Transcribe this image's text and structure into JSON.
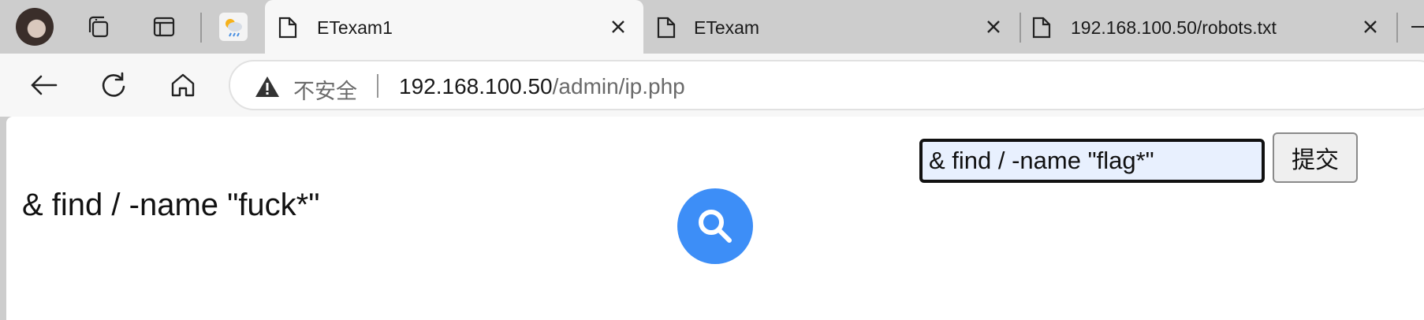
{
  "tabs": [
    {
      "title": "ETexam1",
      "active": true
    },
    {
      "title": "ETexam",
      "active": false
    },
    {
      "title": "192.168.100.50/robots.txt",
      "active": false
    }
  ],
  "toolbar": {
    "security_label": "不安全",
    "url_host": "192.168.100.50",
    "url_path": "/admin/ip.php"
  },
  "page": {
    "echo_text": "& find / -name \"fuck*\"",
    "input_value": "& find / -name \"flag*\"",
    "submit_label": "提交"
  },
  "colors": {
    "accent": "#3d8ef7",
    "input_bg": "#e8f0fe"
  },
  "icons": [
    "profile-avatar",
    "collections-icon",
    "tab-actions-icon",
    "weather-icon",
    "page-icon",
    "close-icon",
    "back-icon",
    "refresh-icon",
    "home-icon",
    "warning-icon",
    "search-icon"
  ]
}
